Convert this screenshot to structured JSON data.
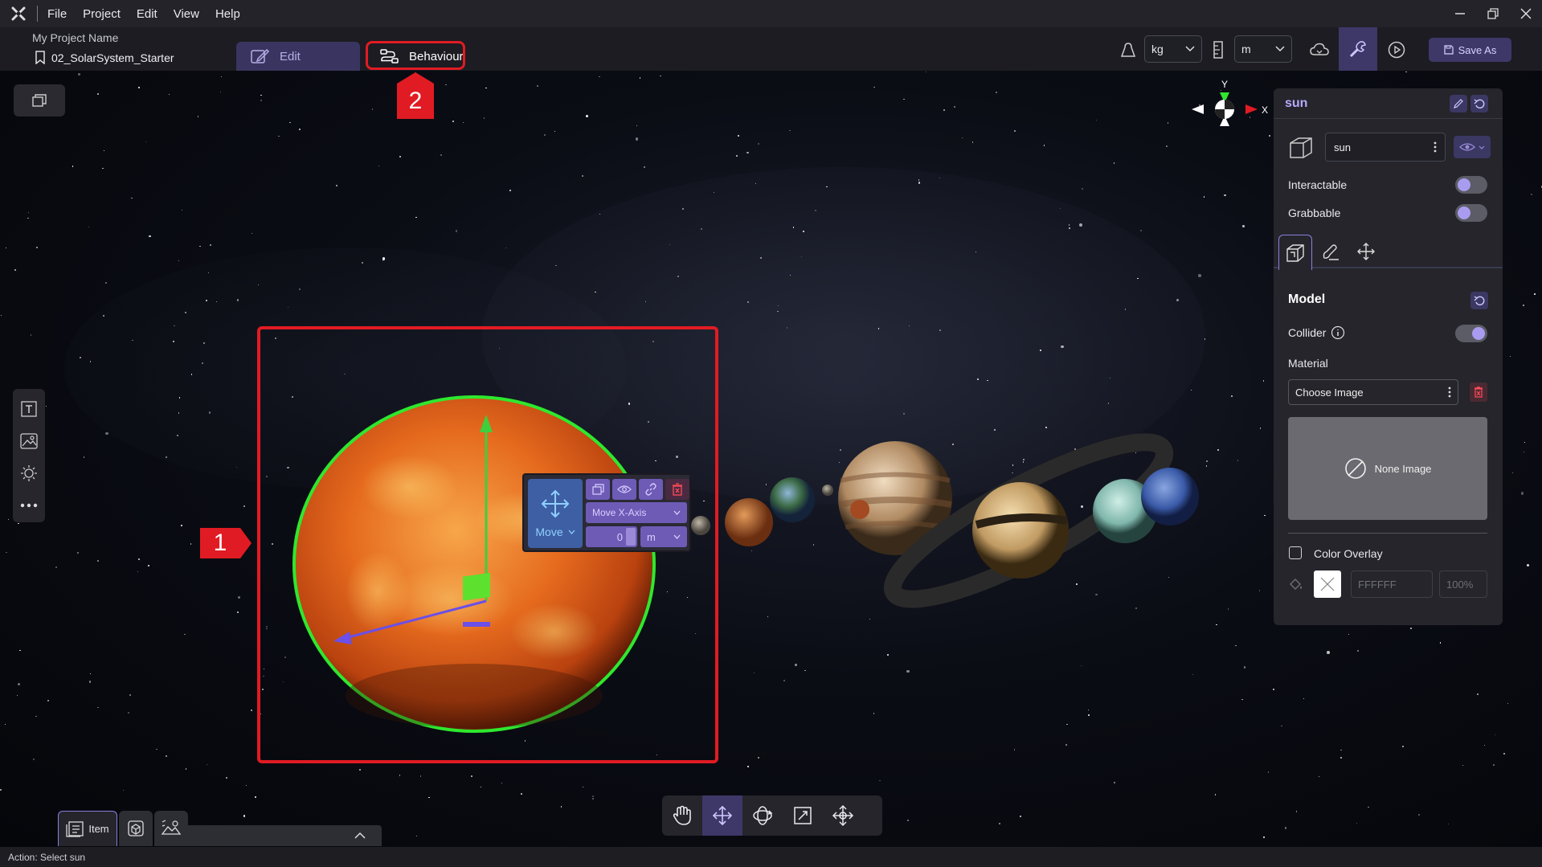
{
  "menu": {
    "items": [
      "File",
      "Project",
      "Edit",
      "View",
      "Help"
    ]
  },
  "header": {
    "project_name": "My Project Name",
    "scene_name": "02_SolarSystem_Starter",
    "tab_edit": "Edit",
    "tab_behaviour": "Behaviour",
    "mass_unit": "kg",
    "length_unit": "m",
    "save_as": "Save As"
  },
  "annotations": {
    "marker_1": "1",
    "marker_2": "2"
  },
  "gizmo_panel": {
    "mode_label": "Move",
    "axis_select": "Move X-Axis",
    "value": "0",
    "unit": "m"
  },
  "axes": {
    "y_label": "Y",
    "x_label": "X"
  },
  "properties": {
    "object_title": "sun",
    "name_value": "sun",
    "interactable_label": "Interactable",
    "grabbable_label": "Grabbable",
    "section_title": "Model",
    "collider_label": "Collider",
    "material_label": "Material",
    "choose_image": "Choose Image",
    "none_image": "None Image",
    "color_overlay_label": "Color Overlay",
    "hex_placeholder": "FFFFFF",
    "opacity_placeholder": "100%",
    "interactable_on": false,
    "grabbable_on": false,
    "collider_on": true
  },
  "bottom_tabs": {
    "item_label": "Item"
  },
  "status": {
    "text": "Action: Select sun"
  },
  "colors": {
    "accent": "#3d3868",
    "highlight_red": "#e11b23",
    "selection_green": "#2ee82e",
    "toggle_knob": "#a99cf0"
  }
}
